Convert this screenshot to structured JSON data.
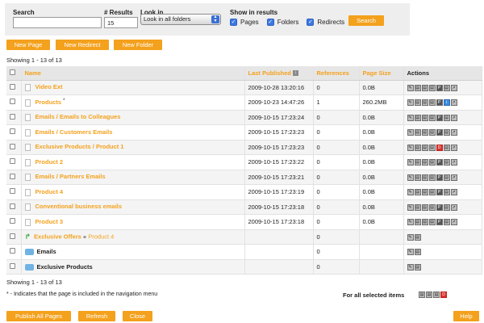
{
  "search": {
    "search_label": "Search",
    "search_value": "",
    "results_label": "# Results",
    "results_value": "15",
    "lookin_label": "Look in",
    "lookin_value": "Look in all folders",
    "show_label": "Show in results",
    "show_options": [
      {
        "label": "Pages",
        "checked": true
      },
      {
        "label": "Folders",
        "checked": true
      },
      {
        "label": "Redirects",
        "checked": true
      }
    ],
    "search_button": "Search"
  },
  "toolbar": {
    "new_page": "New Page",
    "new_redirect": "New Redirect",
    "new_folder": "New Folder"
  },
  "showing_top": "Showing 1 - 13 of 13",
  "showing_bottom": "Showing 1 - 13 of 13",
  "table": {
    "columns": [
      "Name",
      "Last Published",
      "References",
      "Page Size",
      "Actions"
    ],
    "rows": [
      {
        "type": "page",
        "name": "Video Ext",
        "published": "2009-10-28 13:20:16",
        "refs": "0",
        "size": "0.0B",
        "actions": "page"
      },
      {
        "type": "page",
        "name": "Products",
        "nav_mark": "*",
        "published": "2009-10-23 14:47:26",
        "refs": "1",
        "size": "260.2MB",
        "actions": "page-blue"
      },
      {
        "type": "page",
        "name": "Emails / Emails to Colleagues",
        "published": "2009-10-15 17:23:24",
        "refs": "0",
        "size": "0.0B",
        "actions": "page"
      },
      {
        "type": "page",
        "name": "Emails / Customers Emails",
        "published": "2009-10-15 17:23:23",
        "refs": "0",
        "size": "0.0B",
        "actions": "page"
      },
      {
        "type": "page",
        "name": "Exclusive Products / Product 1",
        "published": "2009-10-15 17:23:23",
        "refs": "0",
        "size": "0.0B",
        "actions": "page-red"
      },
      {
        "type": "page",
        "name": "Product 2",
        "published": "2009-10-15 17:23:22",
        "refs": "0",
        "size": "0.0B",
        "actions": "page"
      },
      {
        "type": "page",
        "name": "Emails / Partners Emails",
        "published": "2009-10-15 17:23:21",
        "refs": "0",
        "size": "0.0B",
        "actions": "page"
      },
      {
        "type": "page",
        "name": "Product 4",
        "published": "2009-10-15 17:23:19",
        "refs": "0",
        "size": "0.0B",
        "actions": "page"
      },
      {
        "type": "page",
        "name": "Conventional business emails",
        "published": "2009-10-15 17:23:18",
        "refs": "0",
        "size": "0.0B",
        "actions": "page"
      },
      {
        "type": "page",
        "name": "Product 3",
        "published": "2009-10-15 17:23:18",
        "refs": "0",
        "size": "0.0B",
        "actions": "page"
      },
      {
        "type": "redirect",
        "name": "Exclusive Offers",
        "target_sep": "»",
        "target": "Product 4",
        "published": "",
        "refs": "0",
        "size": "",
        "actions": "short"
      },
      {
        "type": "folder",
        "name": "Emails",
        "published": "",
        "refs": "0",
        "size": "",
        "actions": "short"
      },
      {
        "type": "folder",
        "name": "Exclusive Products",
        "published": "",
        "refs": "0",
        "size": "",
        "actions": "short"
      }
    ]
  },
  "legend": "* - Indicates that the page is included in the navigation menu",
  "for_all_selected": "For all selected items",
  "footer": {
    "publish_all": "Publish All Pages",
    "refresh": "Refresh",
    "close": "Close",
    "help": "Help"
  },
  "colors": {
    "accent": "#f4a11d",
    "header_bg": "#e6e6e6",
    "alt_row": "#f4f4f4"
  }
}
